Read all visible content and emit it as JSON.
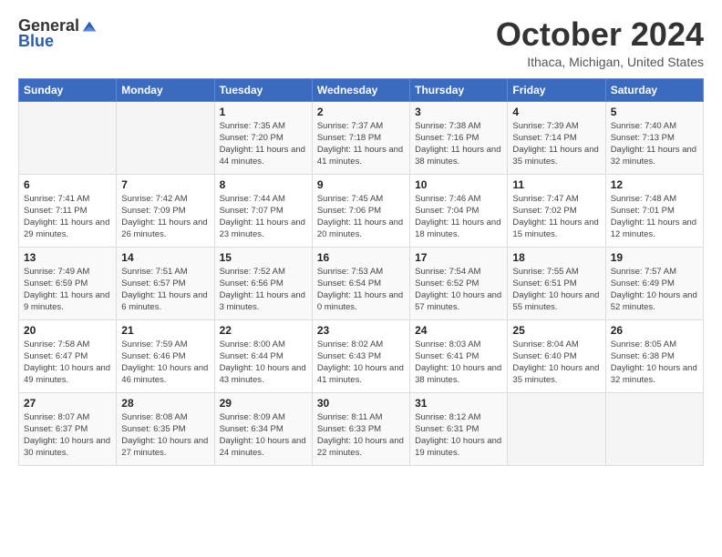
{
  "header": {
    "logo_general": "General",
    "logo_blue": "Blue",
    "month_title": "October 2024",
    "location": "Ithaca, Michigan, United States"
  },
  "weekdays": [
    "Sunday",
    "Monday",
    "Tuesday",
    "Wednesday",
    "Thursday",
    "Friday",
    "Saturday"
  ],
  "weeks": [
    [
      {
        "day": "",
        "empty": true
      },
      {
        "day": "",
        "empty": true
      },
      {
        "day": "1",
        "sunrise": "Sunrise: 7:35 AM",
        "sunset": "Sunset: 7:20 PM",
        "daylight": "Daylight: 11 hours and 44 minutes."
      },
      {
        "day": "2",
        "sunrise": "Sunrise: 7:37 AM",
        "sunset": "Sunset: 7:18 PM",
        "daylight": "Daylight: 11 hours and 41 minutes."
      },
      {
        "day": "3",
        "sunrise": "Sunrise: 7:38 AM",
        "sunset": "Sunset: 7:16 PM",
        "daylight": "Daylight: 11 hours and 38 minutes."
      },
      {
        "day": "4",
        "sunrise": "Sunrise: 7:39 AM",
        "sunset": "Sunset: 7:14 PM",
        "daylight": "Daylight: 11 hours and 35 minutes."
      },
      {
        "day": "5",
        "sunrise": "Sunrise: 7:40 AM",
        "sunset": "Sunset: 7:13 PM",
        "daylight": "Daylight: 11 hours and 32 minutes."
      }
    ],
    [
      {
        "day": "6",
        "sunrise": "Sunrise: 7:41 AM",
        "sunset": "Sunset: 7:11 PM",
        "daylight": "Daylight: 11 hours and 29 minutes."
      },
      {
        "day": "7",
        "sunrise": "Sunrise: 7:42 AM",
        "sunset": "Sunset: 7:09 PM",
        "daylight": "Daylight: 11 hours and 26 minutes."
      },
      {
        "day": "8",
        "sunrise": "Sunrise: 7:44 AM",
        "sunset": "Sunset: 7:07 PM",
        "daylight": "Daylight: 11 hours and 23 minutes."
      },
      {
        "day": "9",
        "sunrise": "Sunrise: 7:45 AM",
        "sunset": "Sunset: 7:06 PM",
        "daylight": "Daylight: 11 hours and 20 minutes."
      },
      {
        "day": "10",
        "sunrise": "Sunrise: 7:46 AM",
        "sunset": "Sunset: 7:04 PM",
        "daylight": "Daylight: 11 hours and 18 minutes."
      },
      {
        "day": "11",
        "sunrise": "Sunrise: 7:47 AM",
        "sunset": "Sunset: 7:02 PM",
        "daylight": "Daylight: 11 hours and 15 minutes."
      },
      {
        "day": "12",
        "sunrise": "Sunrise: 7:48 AM",
        "sunset": "Sunset: 7:01 PM",
        "daylight": "Daylight: 11 hours and 12 minutes."
      }
    ],
    [
      {
        "day": "13",
        "sunrise": "Sunrise: 7:49 AM",
        "sunset": "Sunset: 6:59 PM",
        "daylight": "Daylight: 11 hours and 9 minutes."
      },
      {
        "day": "14",
        "sunrise": "Sunrise: 7:51 AM",
        "sunset": "Sunset: 6:57 PM",
        "daylight": "Daylight: 11 hours and 6 minutes."
      },
      {
        "day": "15",
        "sunrise": "Sunrise: 7:52 AM",
        "sunset": "Sunset: 6:56 PM",
        "daylight": "Daylight: 11 hours and 3 minutes."
      },
      {
        "day": "16",
        "sunrise": "Sunrise: 7:53 AM",
        "sunset": "Sunset: 6:54 PM",
        "daylight": "Daylight: 11 hours and 0 minutes."
      },
      {
        "day": "17",
        "sunrise": "Sunrise: 7:54 AM",
        "sunset": "Sunset: 6:52 PM",
        "daylight": "Daylight: 10 hours and 57 minutes."
      },
      {
        "day": "18",
        "sunrise": "Sunrise: 7:55 AM",
        "sunset": "Sunset: 6:51 PM",
        "daylight": "Daylight: 10 hours and 55 minutes."
      },
      {
        "day": "19",
        "sunrise": "Sunrise: 7:57 AM",
        "sunset": "Sunset: 6:49 PM",
        "daylight": "Daylight: 10 hours and 52 minutes."
      }
    ],
    [
      {
        "day": "20",
        "sunrise": "Sunrise: 7:58 AM",
        "sunset": "Sunset: 6:47 PM",
        "daylight": "Daylight: 10 hours and 49 minutes."
      },
      {
        "day": "21",
        "sunrise": "Sunrise: 7:59 AM",
        "sunset": "Sunset: 6:46 PM",
        "daylight": "Daylight: 10 hours and 46 minutes."
      },
      {
        "day": "22",
        "sunrise": "Sunrise: 8:00 AM",
        "sunset": "Sunset: 6:44 PM",
        "daylight": "Daylight: 10 hours and 43 minutes."
      },
      {
        "day": "23",
        "sunrise": "Sunrise: 8:02 AM",
        "sunset": "Sunset: 6:43 PM",
        "daylight": "Daylight: 10 hours and 41 minutes."
      },
      {
        "day": "24",
        "sunrise": "Sunrise: 8:03 AM",
        "sunset": "Sunset: 6:41 PM",
        "daylight": "Daylight: 10 hours and 38 minutes."
      },
      {
        "day": "25",
        "sunrise": "Sunrise: 8:04 AM",
        "sunset": "Sunset: 6:40 PM",
        "daylight": "Daylight: 10 hours and 35 minutes."
      },
      {
        "day": "26",
        "sunrise": "Sunrise: 8:05 AM",
        "sunset": "Sunset: 6:38 PM",
        "daylight": "Daylight: 10 hours and 32 minutes."
      }
    ],
    [
      {
        "day": "27",
        "sunrise": "Sunrise: 8:07 AM",
        "sunset": "Sunset: 6:37 PM",
        "daylight": "Daylight: 10 hours and 30 minutes."
      },
      {
        "day": "28",
        "sunrise": "Sunrise: 8:08 AM",
        "sunset": "Sunset: 6:35 PM",
        "daylight": "Daylight: 10 hours and 27 minutes."
      },
      {
        "day": "29",
        "sunrise": "Sunrise: 8:09 AM",
        "sunset": "Sunset: 6:34 PM",
        "daylight": "Daylight: 10 hours and 24 minutes."
      },
      {
        "day": "30",
        "sunrise": "Sunrise: 8:11 AM",
        "sunset": "Sunset: 6:33 PM",
        "daylight": "Daylight: 10 hours and 22 minutes."
      },
      {
        "day": "31",
        "sunrise": "Sunrise: 8:12 AM",
        "sunset": "Sunset: 6:31 PM",
        "daylight": "Daylight: 10 hours and 19 minutes."
      },
      {
        "day": "",
        "empty": true
      },
      {
        "day": "",
        "empty": true
      }
    ]
  ]
}
